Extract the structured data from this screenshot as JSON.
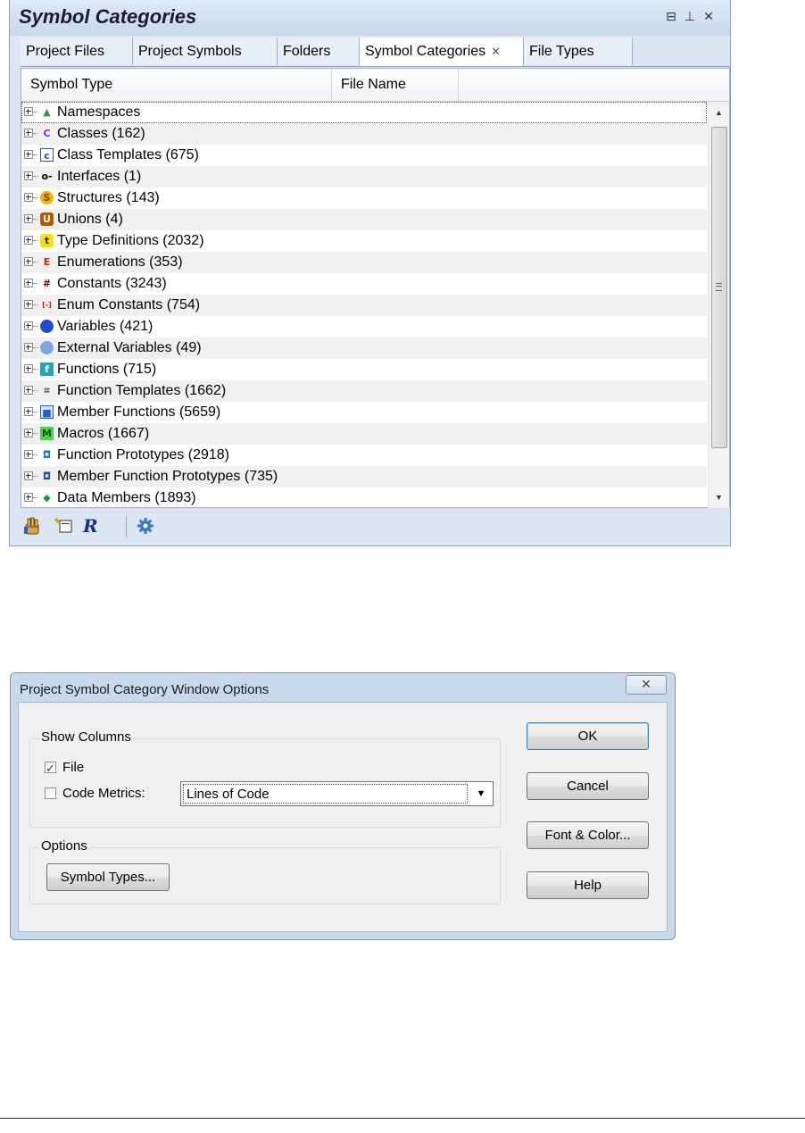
{
  "panel": {
    "title": "Symbol Categories",
    "title_buttons": {
      "float": "⊟",
      "pin": "⊥",
      "close": "✕"
    },
    "tabs": [
      {
        "label": "Project Files"
      },
      {
        "label": "Project Symbols"
      },
      {
        "label": "Folders"
      },
      {
        "label": "Symbol Categories",
        "close": "✕"
      },
      {
        "label": "File Types"
      }
    ],
    "columns": [
      "Symbol Type",
      "File Name"
    ],
    "rows": [
      {
        "label": "Namespaces",
        "icon": "namespace-icon"
      },
      {
        "label": "Classes (162)",
        "icon": "class-icon"
      },
      {
        "label": "Class Templates (675)",
        "icon": "class-template-icon"
      },
      {
        "label": "Interfaces (1)",
        "icon": "interface-icon"
      },
      {
        "label": "Structures (143)",
        "icon": "structure-icon"
      },
      {
        "label": "Unions (4)",
        "icon": "union-icon"
      },
      {
        "label": "Type Definitions (2032)",
        "icon": "typedef-icon"
      },
      {
        "label": "Enumerations (353)",
        "icon": "enumeration-icon"
      },
      {
        "label": "Constants (3243)",
        "icon": "constant-icon"
      },
      {
        "label": "Enum Constants (754)",
        "icon": "enum-constant-icon"
      },
      {
        "label": "Variables (421)",
        "icon": "variable-icon"
      },
      {
        "label": "External Variables (49)",
        "icon": "external-variable-icon"
      },
      {
        "label": "Functions (715)",
        "icon": "function-icon"
      },
      {
        "label": "Function Templates (1662)",
        "icon": "function-template-icon"
      },
      {
        "label": "Member Functions (5659)",
        "icon": "member-function-icon"
      },
      {
        "label": "Macros (1667)",
        "icon": "macro-icon"
      },
      {
        "label": "Function Prototypes (2918)",
        "icon": "function-prototype-icon"
      },
      {
        "label": "Member Function Prototypes (735)",
        "icon": "member-function-prototype-icon"
      },
      {
        "label": "Data Members (1893)",
        "icon": "data-member-icon"
      }
    ],
    "toolbar": [
      "hand-pointer-icon",
      "new-window-icon",
      "r-icon",
      "settings-gear-icon"
    ]
  },
  "dialog": {
    "title": "Project Symbol Category Window Options",
    "close_glyph": "✕",
    "show_columns": {
      "legend": "Show Columns",
      "file": {
        "label": "File",
        "checked": true
      },
      "code_metrics": {
        "label": "Code Metrics:",
        "checked": false
      },
      "metric_value": "Lines of Code"
    },
    "options": {
      "legend": "Options",
      "symbol_types_label": "Symbol Types..."
    },
    "buttons": {
      "ok": "OK",
      "cancel": "Cancel",
      "font_color": "Font & Color...",
      "help": "Help"
    }
  }
}
